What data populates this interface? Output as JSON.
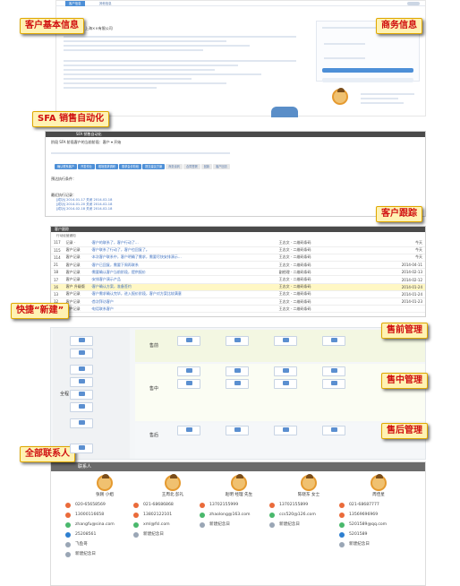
{
  "callouts": {
    "customer_info": "客户基本信息",
    "business_info": "商务信息",
    "sfa": "SFA 销售自动化",
    "follow_up": "客户跟踪",
    "quick_new": "快捷“新建”",
    "pre_sale": "售前管理",
    "in_sale": "售中管理",
    "after_sale": "售后管理",
    "all_contacts": "全部联系人"
  },
  "customer": {
    "tab_main": "客户信息",
    "tab_other": "其他信息",
    "company": "上海××有限公司"
  },
  "sfa": {
    "title": "SFA 销售自动化",
    "row1": "阶段 SFA    阶段客户的当前阶段：客户 ▾   开始",
    "pipeline": [
      "确认联系客户",
      "开发作业",
      "现场需求调研",
      "需求会诊阶段",
      "提交建议方案",
      "商务谈判",
      "合同签署",
      "回款",
      "客户回访"
    ],
    "pipeline_active": 4,
    "exec_label": "预达执行条件：",
    "records_label": "最近执行记录：",
    "records": [
      "[成功] 2014-01-17 关闭 2014-02-18",
      "[成功] 2014-01-20 关闭 2014-02-18",
      "[成功] 2014-02-18 关闭 2014-02-18"
    ]
  },
  "followup": {
    "title": "客户跟踪",
    "subtitle": "行动经营通知",
    "rows": [
      {
        "num": "117",
        "type": "记录 ·",
        "text": "·客户的联系了，客户行动了...",
        "owner": "王志文 · 二维码条码",
        "date": "今天"
      },
      {
        "num": "115",
        "type": "客户记录",
        "text": "·客户联系了行动了，客户也回复了。",
        "owner": "王志文 · 二维码条码",
        "date": "今天"
      },
      {
        "num": "114",
        "type": "客户记录",
        "text": "·本次客户联系中，客户明确了需求，需要尽快安排演示...",
        "owner": "王志文 · 二维码条码",
        "date": "今天"
      },
      {
        "num": "21",
        "type": "客户记录",
        "text": "·客户已回复，需要下周再联系",
        "owner": "王志文 · 二维码条码",
        "date": "2014-04-11"
      },
      {
        "num": "18",
        "type": "客户记录",
        "text": "·需要确认客户当前阶段，提供报价",
        "owner": "副经理 · 二维码条码",
        "date": "2014-02-13"
      },
      {
        "num": "17",
        "type": "客户记录",
        "text": "·安排客户演示产品",
        "owner": "王志文 · 二维码条码",
        "date": "2014-02-12"
      },
      {
        "num": "16",
        "type": "客户 升级版",
        "text": "·客户确认方案，准备签约",
        "owner": "王志文 · 二维码条码",
        "date": "2014-01-24"
      },
      {
        "num": "13",
        "type": "客户记录",
        "text": "·客户需求确认完毕，进入报价阶段，客户对方案比较满意",
        "owner": "王志文 · 二维码条码",
        "date": "2014-01-24"
      },
      {
        "num": "12",
        "type": "客户记录",
        "text": "·首次拜访客户",
        "owner": "王志文 · 二维码条码",
        "date": "2014-01-23"
      },
      {
        "num": "10",
        "type": "客户记录",
        "text": "·电话联系客户",
        "owner": "王志文 · 二维码条码",
        "date": ""
      }
    ]
  },
  "flow": {
    "stage_pre": "售前",
    "stage_in": "售中",
    "stage_after": "售后",
    "all_label": "全程"
  },
  "contacts": {
    "title": "联系人",
    "people": [
      {
        "name": "张刚 小姐",
        "lines": [
          {
            "t": "phone",
            "v": "020-65658569"
          },
          {
            "t": "phone",
            "v": "13000116658"
          },
          {
            "t": "mail",
            "v": "zhangfu@sina.com"
          },
          {
            "t": "qq",
            "v": "25208561"
          },
          {
            "t": "wb",
            "v": "飞鱼哥"
          },
          {
            "t": "wb",
            "v": "新建纪念日"
          }
        ]
      },
      {
        "name": "王周北 彭礼",
        "lines": [
          {
            "t": "phone",
            "v": "021-68686868"
          },
          {
            "t": "phone",
            "v": "13802122101"
          },
          {
            "t": "mail",
            "v": "xml@fsl.com"
          },
          {
            "t": "wb",
            "v": "新建纪念日"
          }
        ]
      },
      {
        "name": "赵明 经理 先生",
        "lines": [
          {
            "t": "phone",
            "v": "13702155999"
          },
          {
            "t": "mail",
            "v": "zhaolong@163.com"
          },
          {
            "t": "wb",
            "v": "新建纪念日"
          }
        ]
      },
      {
        "name": "陈晓东 女士",
        "lines": [
          {
            "t": "phone",
            "v": "13702155899"
          },
          {
            "t": "mail",
            "v": "ccs520@126.com"
          },
          {
            "t": "wb",
            "v": "新建纪念日"
          }
        ]
      },
      {
        "name": "周佳星",
        "lines": [
          {
            "t": "phone",
            "v": "021-68687777"
          },
          {
            "t": "phone",
            "v": "13569696969"
          },
          {
            "t": "mail",
            "v": "5201589@qq.com"
          },
          {
            "t": "qq",
            "v": "5201589"
          },
          {
            "t": "wb",
            "v": "新建纪念日"
          }
        ]
      }
    ]
  }
}
